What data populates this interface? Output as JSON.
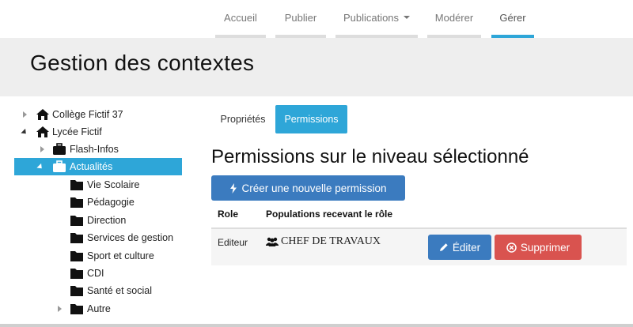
{
  "nav": {
    "items": [
      {
        "label": "Accueil"
      },
      {
        "label": "Publier"
      },
      {
        "label": "Publications"
      },
      {
        "label": "Modérer"
      },
      {
        "label": "Gérer"
      }
    ]
  },
  "header": {
    "title": "Gestion des contextes"
  },
  "tree": {
    "nodes": [
      {
        "label": "Collège Fictif 37",
        "icon": "home-icon"
      },
      {
        "label": "Lycée Fictif",
        "icon": "home-icon"
      },
      {
        "label": "Flash-Infos",
        "icon": "briefcase-icon"
      },
      {
        "label": "Actualités",
        "icon": "briefcase-icon"
      },
      {
        "label": "Vie Scolaire",
        "icon": "folder-icon"
      },
      {
        "label": "Pédagogie",
        "icon": "folder-icon"
      },
      {
        "label": "Direction",
        "icon": "folder-icon"
      },
      {
        "label": "Services de gestion",
        "icon": "folder-icon"
      },
      {
        "label": "Sport et culture",
        "icon": "folder-icon"
      },
      {
        "label": "CDI",
        "icon": "folder-icon"
      },
      {
        "label": "Santé et social",
        "icon": "folder-icon"
      },
      {
        "label": "Autre",
        "icon": "folder-icon"
      }
    ]
  },
  "tabs": [
    {
      "label": "Propriétés"
    },
    {
      "label": "Permissions"
    }
  ],
  "main": {
    "section_title": "Permissions sur le niveau sélectionné",
    "create_button": "Créer une nouvelle permission",
    "table": {
      "headers": [
        "Role",
        "Populations recevant le rôle"
      ],
      "rows": [
        {
          "role": "Editeur",
          "population": "CHEF DE TRAVAUX",
          "edit": "Éditer",
          "delete": "Supprimer"
        }
      ]
    }
  },
  "colors": {
    "accent": "#2ea6d8",
    "primary": "#3b7bbf",
    "danger": "#d9534f"
  }
}
